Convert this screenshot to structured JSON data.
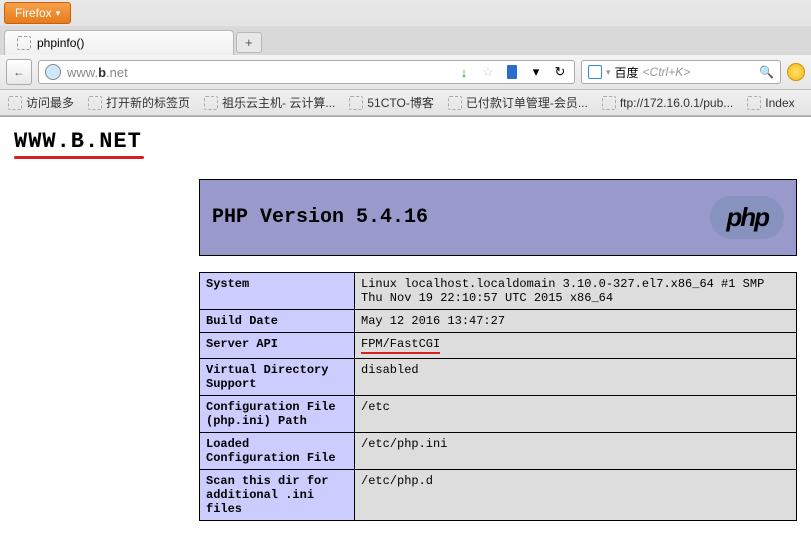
{
  "browser": {
    "menu_label": "Firefox",
    "tab_title": "phpinfo()",
    "new_tab": "+",
    "back": "←",
    "url_grey": "www.",
    "url_bold": "b",
    "url_grey2": ".net",
    "icons": {
      "arrow": "↓",
      "star": "☆",
      "dropdown": "▾",
      "reload": "↻",
      "search": "🔍"
    },
    "search_engine": "百度",
    "search_placeholder": "<Ctrl+K>",
    "bookmarks": [
      "访问最多",
      "打开新的标签页",
      "祖乐云主机- 云计算...",
      "51CTO-博客",
      "已付款订单管理-会员...",
      "ftp://172.16.0.1/pub...",
      "Index"
    ]
  },
  "page": {
    "heading": "WWW.B.NET",
    "php_version_label": "PHP Version 5.4.16",
    "logo_text": "php",
    "rows": [
      {
        "k": "System",
        "v": "Linux localhost.localdomain 3.10.0-327.el7.x86_64 #1 SMP Thu Nov 19 22:10:57 UTC 2015 x86_64"
      },
      {
        "k": "Build Date",
        "v": "May 12 2016 13:47:27"
      },
      {
        "k": "Server API",
        "v": "FPM/FastCGI"
      },
      {
        "k": "Virtual Directory Support",
        "v": "disabled"
      },
      {
        "k": "Configuration File (php.ini) Path",
        "v": "/etc"
      },
      {
        "k": "Loaded Configuration File",
        "v": "/etc/php.ini"
      },
      {
        "k": "Scan this dir for additional .ini files",
        "v": "/etc/php.d"
      }
    ]
  }
}
